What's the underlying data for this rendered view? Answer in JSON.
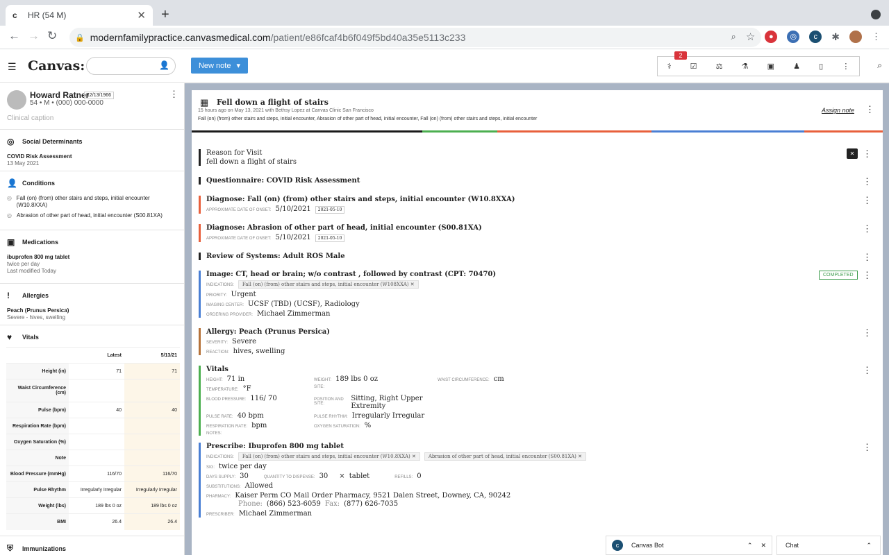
{
  "browser": {
    "tab_title": "HR (54 M)",
    "url_host": "modernfamilypractice.canvasmedical.com",
    "url_path": "/patient/e86fcaf4b6f049f5bd40a35e5113c233"
  },
  "app": {
    "logo": "Canvas:",
    "new_note_label": "New note",
    "notification_count": "2"
  },
  "patient": {
    "name": "Howard Ratner",
    "dob": "12/13/1966",
    "info": "54 • M • (000) 000-0000",
    "caption": "Clinical caption"
  },
  "sidebar": {
    "social": {
      "title": "Social Determinants",
      "item": "COVID Risk Assessment",
      "date": "13 May 2021"
    },
    "conditions": {
      "title": "Conditions",
      "items": [
        "Fall (on) (from) other stairs and steps, initial encounter (W10.8XXA)",
        "Abrasion of other part of head, initial encounter (S00.81XA)"
      ]
    },
    "medications": {
      "title": "Medications",
      "name": "ibuprofen 800 mg tablet",
      "sig": "twice per day",
      "modified": "Last modified Today"
    },
    "allergies": {
      "title": "Allergies",
      "name": "Peach (Prunus Persica)",
      "detail": "Severe - hives, swelling"
    },
    "vitals": {
      "title": "Vitals",
      "col1": "Latest",
      "col2": "5/13/21",
      "rows": [
        {
          "label": "Height (in)",
          "latest": "71",
          "prev": "71"
        },
        {
          "label": "Waist Circumference (cm)",
          "latest": "",
          "prev": ""
        },
        {
          "label": "Pulse (bpm)",
          "latest": "40",
          "prev": "40"
        },
        {
          "label": "Respiration Rate (bpm)",
          "latest": "",
          "prev": ""
        },
        {
          "label": "Oxygen Saturation (%)",
          "latest": "",
          "prev": ""
        },
        {
          "label": "Note",
          "latest": "",
          "prev": ""
        },
        {
          "label": "Blood Pressure (mmHg)",
          "latest": "116/70",
          "prev": "116/70"
        },
        {
          "label": "Pulse Rhythm",
          "latest": "Irregularly Irregular",
          "prev": "Irregularly Irregular"
        },
        {
          "label": "Weight (lbs)",
          "latest": "189 lbs 0 oz",
          "prev": "189 lbs 0 oz"
        },
        {
          "label": "BMI",
          "latest": "26.4",
          "prev": "26.4"
        }
      ]
    },
    "immunizations": {
      "title": "Immunizations"
    }
  },
  "note": {
    "title": "Fell down a flight of stairs",
    "meta": "15 hours ago on May 13, 2021 with Bethsy Lopez at Canvas Clinic San Francisco",
    "summary": "Fall (on) (from) other stairs and steps, initial encounter, Abrasion of other part of head, initial encounter, Fall (on) (from) other stairs and steps, initial encounter",
    "assign": "Assign note",
    "stripe_colors": [
      "#1a1a1a",
      "#4caf50",
      "#e8603c",
      "#4a7fd4",
      "#e8603c"
    ]
  },
  "commands": {
    "rfv": {
      "heading": "Reason for Visit",
      "text": "fell down a flight of stairs"
    },
    "questionnaire": {
      "heading": "Questionnaire: COVID Risk Assessment"
    },
    "diag1": {
      "heading": "Diagnose: Fall (on) (from) other stairs and steps, initial encounter  (W10.8XXA)",
      "k": "Approximate date of onset:",
      "v": "5/10/2021",
      "tag": "2021-05-10"
    },
    "diag2": {
      "heading": "Diagnose: Abrasion of other part of head, initial encounter  (S00.81XA)",
      "k": "Approximate date of onset:",
      "v": "5/10/2021",
      "tag": "2021-05-10"
    },
    "ros": {
      "heading": "Review of Systems: Adult ROS Male"
    },
    "image": {
      "heading": "Image: CT, head or brain; w/o contrast , followed by contrast (CPT: 70470)",
      "status": "COMPLETED",
      "k_ind": "Indications:",
      "indication": "Fall (on) (from) other stairs and steps, initial encounter (W108XXA)",
      "k_pri": "Priority:",
      "priority": "Urgent",
      "k_center": "Imaging center:",
      "center": "UCSF (TBD) (UCSF), Radiology",
      "k_ord": "Ordering provider:",
      "ordering": "Michael Zimmerman"
    },
    "allergy": {
      "heading": "Allergy: Peach (Prunus Persica)",
      "k_sev": "Severity:",
      "severity": "Severe",
      "k_react": "Reaction:",
      "reaction": "hives, swelling"
    },
    "vitals": {
      "heading": "Vitals",
      "height_k": "Height:",
      "height_v": "71 in",
      "weight_k": "Weight:",
      "weight_v": "189 lbs 0 oz",
      "waist_k": "Waist circumference:",
      "waist_v": "cm",
      "temp_k": "Temperature:",
      "temp_v": "°F",
      "site_k": "Site:",
      "bp_k": "Blood pressure:",
      "bp_v": "116/ 70",
      "pos_k": "Position and site:",
      "pos_v": "Sitting, Right Upper Extremity",
      "pulse_k": "Pulse rate:",
      "pulse_v": "40 bpm",
      "rhythm_k": "Pulse rhythm:",
      "rhythm_v": "Irregularly Irregular",
      "resp_k": "Respiration rate:",
      "resp_v": "bpm",
      "o2_k": "Oxygen saturation:",
      "o2_v": "%",
      "notes_k": "Notes:"
    },
    "prescribe": {
      "heading": "Prescribe: Ibuprofen 800 mg tablet",
      "k_ind": "Indications:",
      "ind1": "Fall (on) (from) other stairs and steps, initial encounter  (W10.8XXA)",
      "ind2": "Abrasion of other part of head, initial encounter  (S00.81XA)",
      "k_sig": "Sig:",
      "sig": "twice per day",
      "k_days": "Days supply:",
      "days": "30",
      "k_qty": "Quantity to dispense:",
      "qty": "30",
      "qty_unit": "tablet",
      "k_refills": "Refills:",
      "refills": "0",
      "k_subs": "Substitutions:",
      "subs": "Allowed",
      "k_pharm": "Pharmacy:",
      "pharmacy": "Kaiser Perm CO Mail Order Pharmacy, 9521 Dalen Street, Downey, CA, 90242",
      "phone_k": "Phone:",
      "phone": "(866) 523-6059",
      "fax_k": "Fax:",
      "fax": "(877) 626-7035",
      "k_prescriber": "Prescriber:",
      "prescriber": "Michael Zimmerman"
    }
  },
  "bottom": {
    "bot_label": "Canvas Bot",
    "chat_label": "Chat"
  }
}
